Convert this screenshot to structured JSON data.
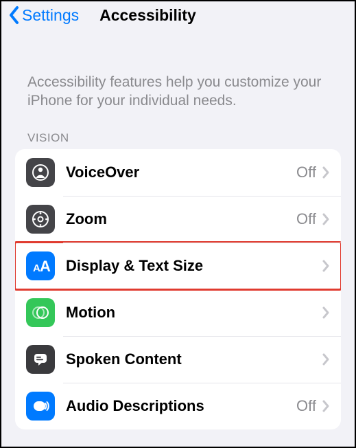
{
  "nav": {
    "back_label": "Settings",
    "title": "Accessibility"
  },
  "intro": "Accessibility features help you customize your iPhone for your individual needs.",
  "sections": {
    "vision": {
      "header": "VISION",
      "items": [
        {
          "label": "VoiceOver",
          "status": "Off"
        },
        {
          "label": "Zoom",
          "status": "Off"
        },
        {
          "label": "Display & Text Size",
          "status": ""
        },
        {
          "label": "Motion",
          "status": ""
        },
        {
          "label": "Spoken Content",
          "status": ""
        },
        {
          "label": "Audio Descriptions",
          "status": "Off"
        }
      ]
    }
  }
}
